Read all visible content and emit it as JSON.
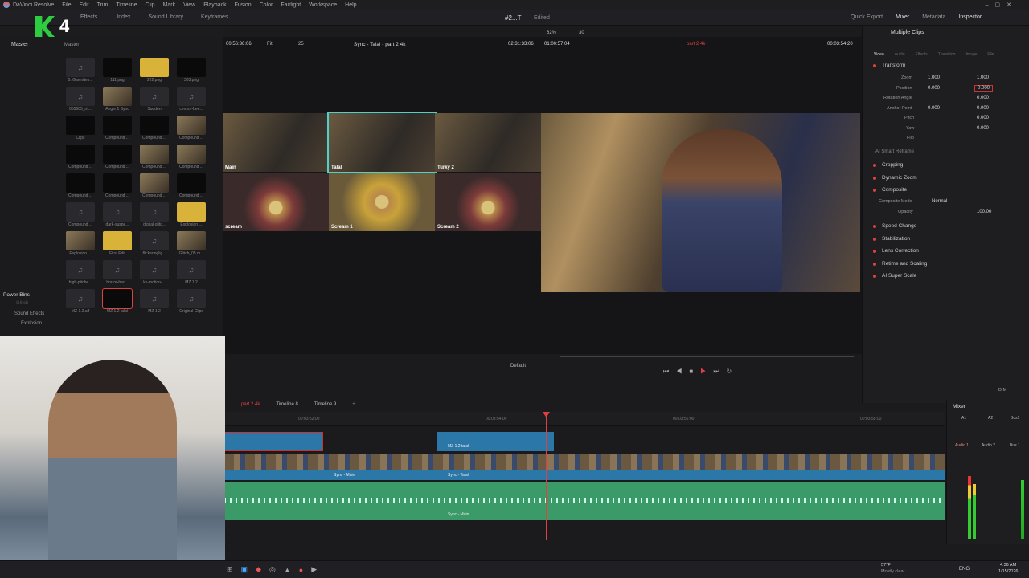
{
  "menubar": {
    "app": "DaVinci Resolve",
    "items": [
      "File",
      "Edit",
      "Trim",
      "Timeline",
      "Clip",
      "Mark",
      "View",
      "Playback",
      "Fusion",
      "Color",
      "Fairlight",
      "Workspace",
      "Help"
    ]
  },
  "tabs": {
    "effects": "Effects",
    "index": "Index",
    "sound_library": "Sound Library",
    "keyframes": "Keyframes",
    "project": "#2...T",
    "edited": "Edited",
    "quick_export": "Quick Export",
    "mixer": "Mixer",
    "metadata": "Metadata",
    "inspector": "Inspector"
  },
  "media_pool": {
    "master": "Master",
    "master2": "Master",
    "power_bins": "Power Bins",
    "bins": [
      "Glitch",
      "Sound Effects",
      "Explosion"
    ],
    "clips": [
      "5. Gavinttes...",
      "111.png",
      "222.png",
      "333.png",
      "055685_nt...",
      "Angle 1 Sync",
      "Sudden",
      "censor-bee...",
      "Clips",
      "Compound ...",
      "Compound ...",
      "Compound ...",
      "Compound ...",
      "Compound ...",
      "Compound ...",
      "Compound ...",
      "Compound ...",
      "Compound ...",
      "Compound ...",
      "Compound ...",
      "Compound ...",
      "dark-suspe...",
      "digital-glitc...",
      "Explosion ...",
      "Explosion ...",
      "First Edit",
      "flickeringlig...",
      "Glitch_05.m...",
      "high-pitche...",
      "horror-bac...",
      "ks-motion-...",
      "MZ 1.2",
      "MZ 1.2.aif",
      "MZ 1.2 talal",
      "MZ 1.2",
      "Original Clips"
    ]
  },
  "viewer": {
    "src_tc": "00:56:36:06",
    "fit": "Fit",
    "fps": "25",
    "title": "Sync - Talal - part 2 4k",
    "dur": "02:31:33:06",
    "pos": "01:00:57:04",
    "zoom": "62%",
    "zoom2": "30",
    "timeline_name": "part 2 4k",
    "rec_tc": "00:03:54:20",
    "default": "Default"
  },
  "multicam": [
    "Main",
    "Talal",
    "Turky 2",
    "scream",
    "Scream 1",
    "Scream 2"
  ],
  "inspector": {
    "title": "Multiple Clips",
    "tabs": [
      "Video",
      "Audio",
      "Effects",
      "Transition",
      "Image",
      "File"
    ],
    "transform": "Transform",
    "zoom_label": "Zoom",
    "zoom_x": "1.000",
    "zoom_y": "1.000",
    "position_label": "Position",
    "pos_x": "0.000",
    "pos_y": "0.000",
    "rotation_label": "Rotation Angle",
    "rotation": "0.000",
    "anchor_label": "Anchor Point",
    "anchor_x": "0.000",
    "anchor_y": "0.000",
    "pitch_label": "Pitch",
    "pitch": "0.000",
    "yaw_label": "Yaw",
    "yaw": "0.000",
    "flip_label": "Flip",
    "smart_reframe": "AI Smart Reframe",
    "cropping": "Cropping",
    "dynamic_zoom": "Dynamic Zoom",
    "composite": "Composite",
    "composite_mode_label": "Composite Mode",
    "composite_mode": "Normal",
    "opacity_label": "Opacity",
    "opacity": "100.00",
    "speed_change": "Speed Change",
    "stabilization": "Stabilization",
    "lens_correction": "Lens Correction",
    "retime": "Retime and Scaling",
    "super_scale": "AI Super Scale"
  },
  "timeline": {
    "tabs": [
      "part 2 4k",
      "Timeline 8",
      "Timeline 9"
    ],
    "ruler": [
      "00:03:52:00",
      "00:03:54:00",
      "00:03:56:00",
      "00:03:58:00"
    ],
    "clip_title": "MZ 1.2 talal",
    "clip_sync_main": "Sync - Main",
    "clip_sync_talal": "Sync - Talal",
    "clip_sync_main2": "Sync - Main"
  },
  "mixer": {
    "title": "Mixer",
    "dim": "DIM",
    "ch": [
      "A1",
      "A2",
      "Bus1"
    ],
    "labels": [
      "Audio 1",
      "Audio 2",
      "Bus 1"
    ]
  },
  "taskbar": {
    "weather_temp": "57°F",
    "weather": "Mostly clear",
    "lang": "ENG",
    "time": "4:36 AM",
    "date": "1/15/2026"
  },
  "overlay": {
    "logo_num": "4"
  }
}
